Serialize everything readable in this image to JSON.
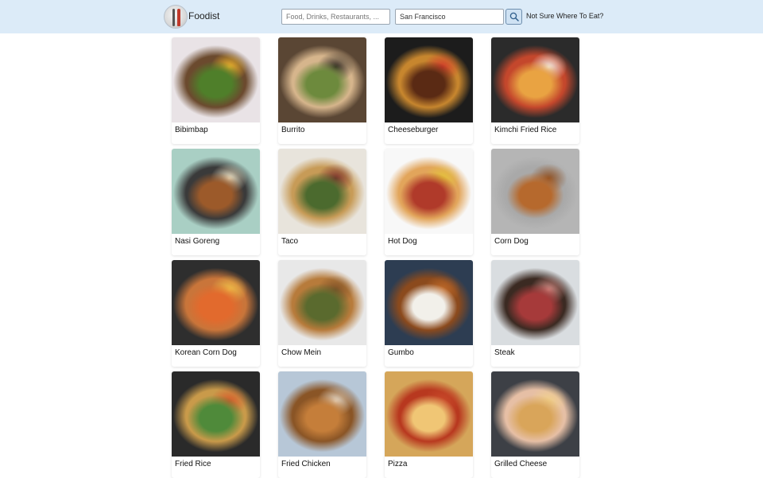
{
  "header": {
    "brand": "Foodist",
    "search_placeholder": "Food, Drinks, Restaurants, ...",
    "location_value": "San Francisco",
    "not_sure_label": "Not Sure Where To Eat?"
  },
  "foods": [
    {
      "label": "Bibimbap",
      "colors": [
        "#e9e3e6",
        "#6b4a2e",
        "#4f7f2a",
        "#f1b62c"
      ]
    },
    {
      "label": "Burrito",
      "colors": [
        "#5a4634",
        "#d6b58c",
        "#6d8a3d",
        "#2d2620"
      ]
    },
    {
      "label": "Cheeseburger",
      "colors": [
        "#1c1c1c",
        "#c7862e",
        "#5a2a14",
        "#d33b2a"
      ]
    },
    {
      "label": "Kimchi Fried Rice",
      "colors": [
        "#2b2b2b",
        "#c4472c",
        "#e9a342",
        "#f4f1e8"
      ]
    },
    {
      "label": "Nasi Goreng",
      "colors": [
        "#a9cfc4",
        "#3a3a3a",
        "#9c5a2a",
        "#f3e7c8"
      ]
    },
    {
      "label": "Taco",
      "colors": [
        "#e8e4dc",
        "#c79b57",
        "#4b6a2e",
        "#7a2e2a"
      ]
    },
    {
      "label": "Hot Dog",
      "colors": [
        "#f8f8f8",
        "#e2a55b",
        "#b03a2a",
        "#e4c33a"
      ]
    },
    {
      "label": "Corn Dog",
      "colors": [
        "#b5b5b5",
        "#a9a9a9",
        "#b6692d",
        "#8e4e1f"
      ]
    },
    {
      "label": "Korean Corn Dog",
      "colors": [
        "#2e2e2e",
        "#c9753a",
        "#e26a2d",
        "#f0c048"
      ]
    },
    {
      "label": "Chow Mein",
      "colors": [
        "#e8e8e8",
        "#b77b3b",
        "#5a6a2e",
        "#7d5026"
      ]
    },
    {
      "label": "Gumbo",
      "colors": [
        "#2d3d52",
        "#8b4a1d",
        "#f2f0ea",
        "#c26b2a"
      ]
    },
    {
      "label": "Steak",
      "colors": [
        "#d9dde0",
        "#3b2a22",
        "#a63a3a",
        "#d48b84"
      ]
    },
    {
      "label": "Fried Rice",
      "colors": [
        "#2a2a2a",
        "#c99a4a",
        "#4f8a3a",
        "#d65a2a"
      ]
    },
    {
      "label": "Fried Chicken",
      "colors": [
        "#b7c7d7",
        "#8a5526",
        "#c57e3a",
        "#e8dccb"
      ]
    },
    {
      "label": "Pizza",
      "colors": [
        "#d5a65a",
        "#b8381f",
        "#f0c675",
        "#c94a2a"
      ]
    },
    {
      "label": "Grilled Cheese",
      "colors": [
        "#3d4046",
        "#e6bfa5",
        "#d9a55a",
        "#f1d08a"
      ]
    }
  ]
}
